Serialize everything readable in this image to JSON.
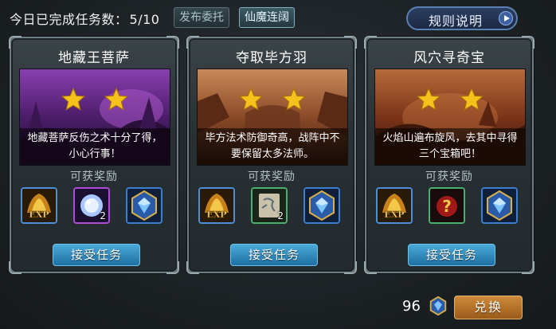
{
  "header": {
    "progress_label": "今日已完成任务数：",
    "progress_value": "5/10",
    "tab_publish": "发布委托",
    "tab_xianmo": "仙魔连阔",
    "rules_label": "规则说明"
  },
  "cards": [
    {
      "title": "地藏王菩萨",
      "stars": 2,
      "desc": "地藏菩萨反伤之术十分了得，小心行事！",
      "rewards_label": "可获奖励",
      "rewards": [
        {
          "icon": "exp-icon",
          "count": ""
        },
        {
          "icon": "spirit-orb-icon",
          "count": "2"
        },
        {
          "icon": "blue-gem-icon",
          "count": ""
        }
      ],
      "accept_label": "接受任务"
    },
    {
      "title": "夺取毕方羽",
      "stars": 2,
      "desc": "毕方法术防御奇高，战阵中不要保留太多法师。",
      "rewards_label": "可获奖励",
      "rewards": [
        {
          "icon": "exp-icon",
          "count": ""
        },
        {
          "icon": "scroll-icon",
          "count": "2"
        },
        {
          "icon": "blue-gem-icon",
          "count": ""
        }
      ],
      "accept_label": "接受任务"
    },
    {
      "title": "风穴寻奇宝",
      "stars": 2,
      "desc": "火焰山遍布旋风，去其中寻得三个宝箱吧！",
      "rewards_label": "可获奖励",
      "rewards": [
        {
          "icon": "exp-icon",
          "count": ""
        },
        {
          "icon": "mystery-item-icon",
          "count": ""
        },
        {
          "icon": "blue-gem-icon",
          "count": ""
        }
      ],
      "accept_label": "接受任务"
    }
  ],
  "footer": {
    "currency_value": "96",
    "exchange_label": "兑换"
  },
  "colors": {
    "accept_button": "#2f8ac0",
    "exchange_button": "#c07a2e",
    "star": "#f5c21b"
  }
}
